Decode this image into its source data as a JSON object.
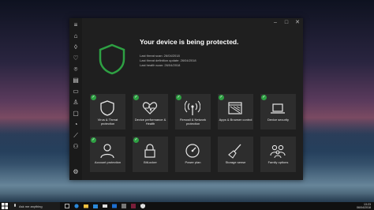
{
  "hero": {
    "title": "Your device is being protected.",
    "lines": [
      "Last threat scan: 26/04/2018",
      "Last threat definition update: 26/04/2018",
      "Last health scan: 26/04/2018"
    ]
  },
  "tiles": [
    {
      "label": "Virus & Threat protection",
      "icon": "shield-outline-icon",
      "ok": true
    },
    {
      "label": "Device performance & Health",
      "icon": "heart-pulse-icon",
      "ok": true
    },
    {
      "label": "Firewall & Network protection",
      "icon": "antenna-icon",
      "ok": true
    },
    {
      "label": "Apps & Browser control",
      "icon": "browser-window-icon",
      "ok": true
    },
    {
      "label": "Device security",
      "icon": "laptop-icon",
      "ok": true
    },
    {
      "label": "Account protection",
      "icon": "person-icon",
      "ok": true
    },
    {
      "label": "BitLocker",
      "icon": "lock-icon",
      "ok": true
    },
    {
      "label": "Power plan",
      "icon": "gauge-icon",
      "ok": false
    },
    {
      "label": "Storage sense",
      "icon": "broom-icon",
      "ok": false
    },
    {
      "label": "Family options",
      "icon": "family-icon",
      "ok": false
    }
  ],
  "taskbar": {
    "search_placeholder": "Ask me anything",
    "time": "13:23",
    "date": "06/04/2018"
  },
  "colors": {
    "accent_green": "#2ea043",
    "window_bg": "#1f1f1f",
    "tile_bg": "#2d2d2d",
    "accent_blue": "#2b88d8"
  }
}
